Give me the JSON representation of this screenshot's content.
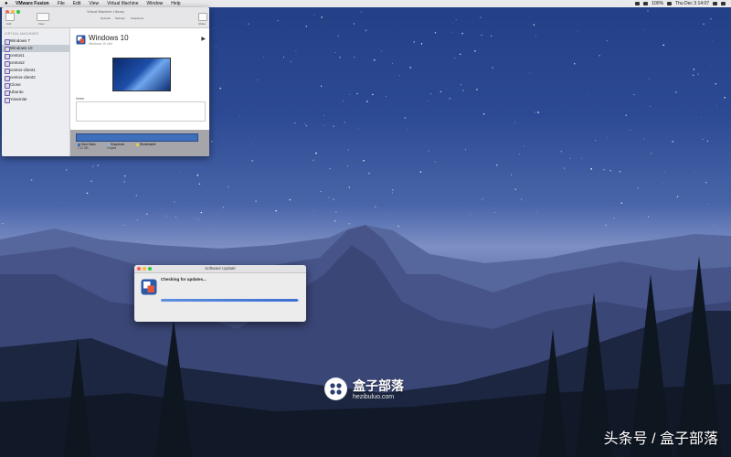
{
  "menubar": {
    "app": "VMware Fusion",
    "items": [
      "File",
      "Edit",
      "View",
      "Virtual Machine",
      "Window",
      "Help"
    ],
    "battery": "100%",
    "clock": "Thu Dec 3 14:07"
  },
  "library": {
    "window_title": "Virtual Machine Library",
    "toolbar": {
      "add_label": "Add",
      "view_label": "View",
      "network_label": "Network",
      "settings_label": "Settings",
      "snapshots_label": "Snapshots",
      "share_label": "Share"
    },
    "sidebar_heading": "VIRTUAL MACHINES",
    "vms": [
      "Windows 7",
      "Windows 10",
      "centos1",
      "centos2",
      "centos-client1",
      "centos-client2",
      "Clone",
      "Ubuntu",
      "Yosemite"
    ],
    "selected_index": 1,
    "detail": {
      "name": "Windows 10",
      "subtitle": "Windows 10 x64",
      "notes_label": "Notes",
      "legend": [
        {
          "label": "Hard Disks",
          "value": "7.11 GB",
          "color": "#3e6fbb"
        },
        {
          "label": "Snapshots",
          "value": "0 bytes",
          "color": "#8fb0e0"
        },
        {
          "label": "Reclaimable",
          "value": "",
          "color": "#d8d24a"
        }
      ]
    }
  },
  "update": {
    "title": "Software Update",
    "message": "Checking for updates...",
    "progress": 0.99
  },
  "watermark": {
    "brand": "盒子部落",
    "url": "hezibuluo.com",
    "corner": "头条号 / 盒子部落"
  }
}
